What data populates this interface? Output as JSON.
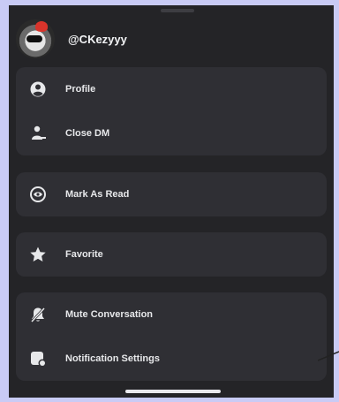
{
  "header": {
    "username": "@CKezyyy"
  },
  "groups": [
    {
      "items": [
        {
          "label": "Profile",
          "icon": "user-circle-icon"
        },
        {
          "label": "Close DM",
          "icon": "person-leave-icon"
        }
      ]
    },
    {
      "items": [
        {
          "label": "Mark As Read",
          "icon": "eye-circle-icon"
        }
      ]
    },
    {
      "items": [
        {
          "label": "Favorite",
          "icon": "star-icon"
        }
      ]
    },
    {
      "items": [
        {
          "label": "Mute Conversation",
          "icon": "bell-slash-icon"
        },
        {
          "label": "Notification Settings",
          "icon": "bell-settings-icon"
        }
      ]
    }
  ],
  "colors": {
    "outer_background": "#c9cbf5",
    "sheet_background": "#242427",
    "card_background": "#2f2f34",
    "text": "#e7e8ea"
  }
}
